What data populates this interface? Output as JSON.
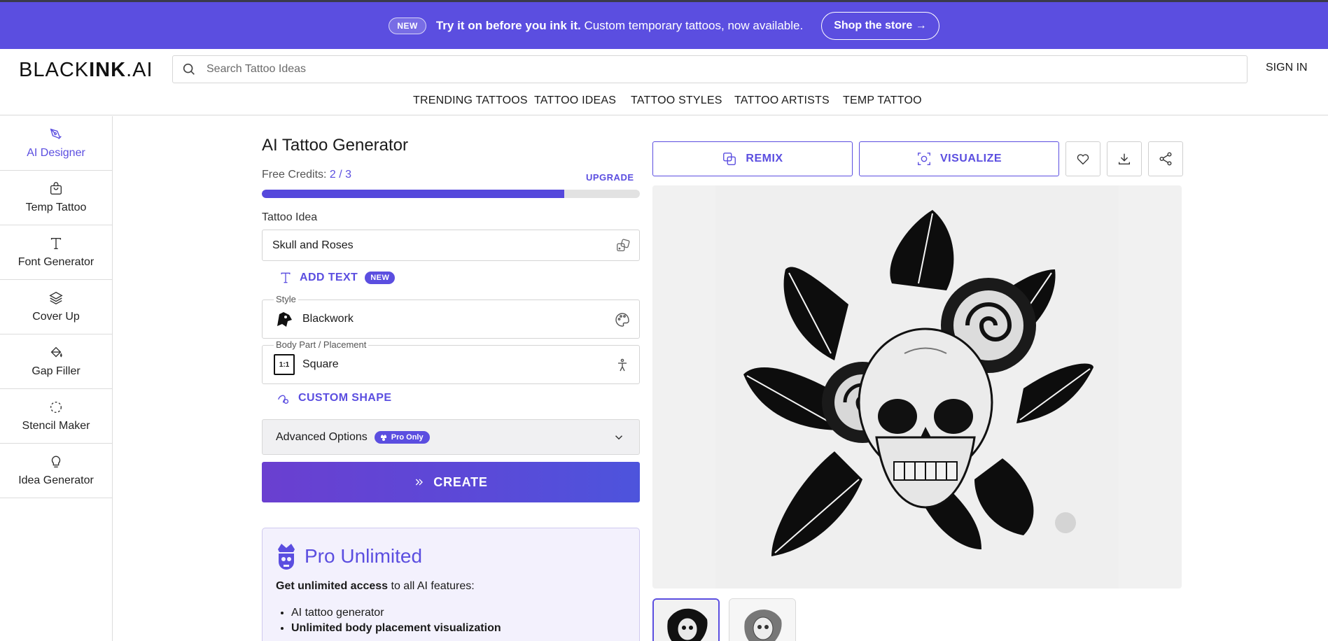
{
  "promo": {
    "badge": "NEW",
    "headline": "Try it on before you ink it.",
    "subtext": "Custom temporary tattoos, now available.",
    "cta": "Shop the store →"
  },
  "header": {
    "logo_light": "BLACK",
    "logo_bold": "INK",
    "logo_suffix": ".AI",
    "search_placeholder": "Search Tattoo Ideas",
    "signin": "SIGN IN"
  },
  "nav": {
    "items": [
      "TRENDING TATTOOS",
      "TATTOO IDEAS",
      "TATTOO STYLES",
      "TATTOO ARTISTS",
      "TEMP TATTOO"
    ]
  },
  "sidebar": {
    "items": [
      {
        "label": "AI Designer",
        "icon": "pen-nib-icon",
        "active": true
      },
      {
        "label": "Temp Tattoo",
        "icon": "shopping-bag-icon",
        "active": false
      },
      {
        "label": "Font Generator",
        "icon": "text-t-icon",
        "active": false
      },
      {
        "label": "Cover Up",
        "icon": "layers-icon",
        "active": false
      },
      {
        "label": "Gap Filler",
        "icon": "paint-bucket-icon",
        "active": false
      },
      {
        "label": "Stencil Maker",
        "icon": "dashed-circle-icon",
        "active": false
      },
      {
        "label": "Idea Generator",
        "icon": "lightbulb-icon",
        "active": false
      }
    ]
  },
  "generator": {
    "title": "AI Tattoo Generator",
    "credits_label": "Free Credits:",
    "credits_value": "2 / 3",
    "credits_progress": 0.8,
    "upgrade": "UPGRADE",
    "idea_label": "Tattoo Idea",
    "idea_value": "Skull and Roses",
    "add_text": "ADD TEXT",
    "add_text_badge": "NEW",
    "style_legend": "Style",
    "style_value": "Blackwork",
    "placement_legend": "Body Part / Placement",
    "placement_value": "Square",
    "placement_ratio": "1:1",
    "custom_shape": "CUSTOM SHAPE",
    "advanced": "Advanced Options",
    "pro_only": "Pro Only",
    "create": "CREATE"
  },
  "pro_card": {
    "title": "Pro Unlimited",
    "desc_bold": "Get unlimited access",
    "desc_rest": " to all AI features:",
    "features": [
      {
        "text": "AI tattoo generator",
        "bold": false
      },
      {
        "text": "Unlimited body placement visualization",
        "bold": true
      }
    ]
  },
  "actions": {
    "remix": "REMIX",
    "visualize": "VISUALIZE"
  },
  "colors": {
    "accent": "#5b4ee0",
    "banner": "#5b4ee0"
  }
}
